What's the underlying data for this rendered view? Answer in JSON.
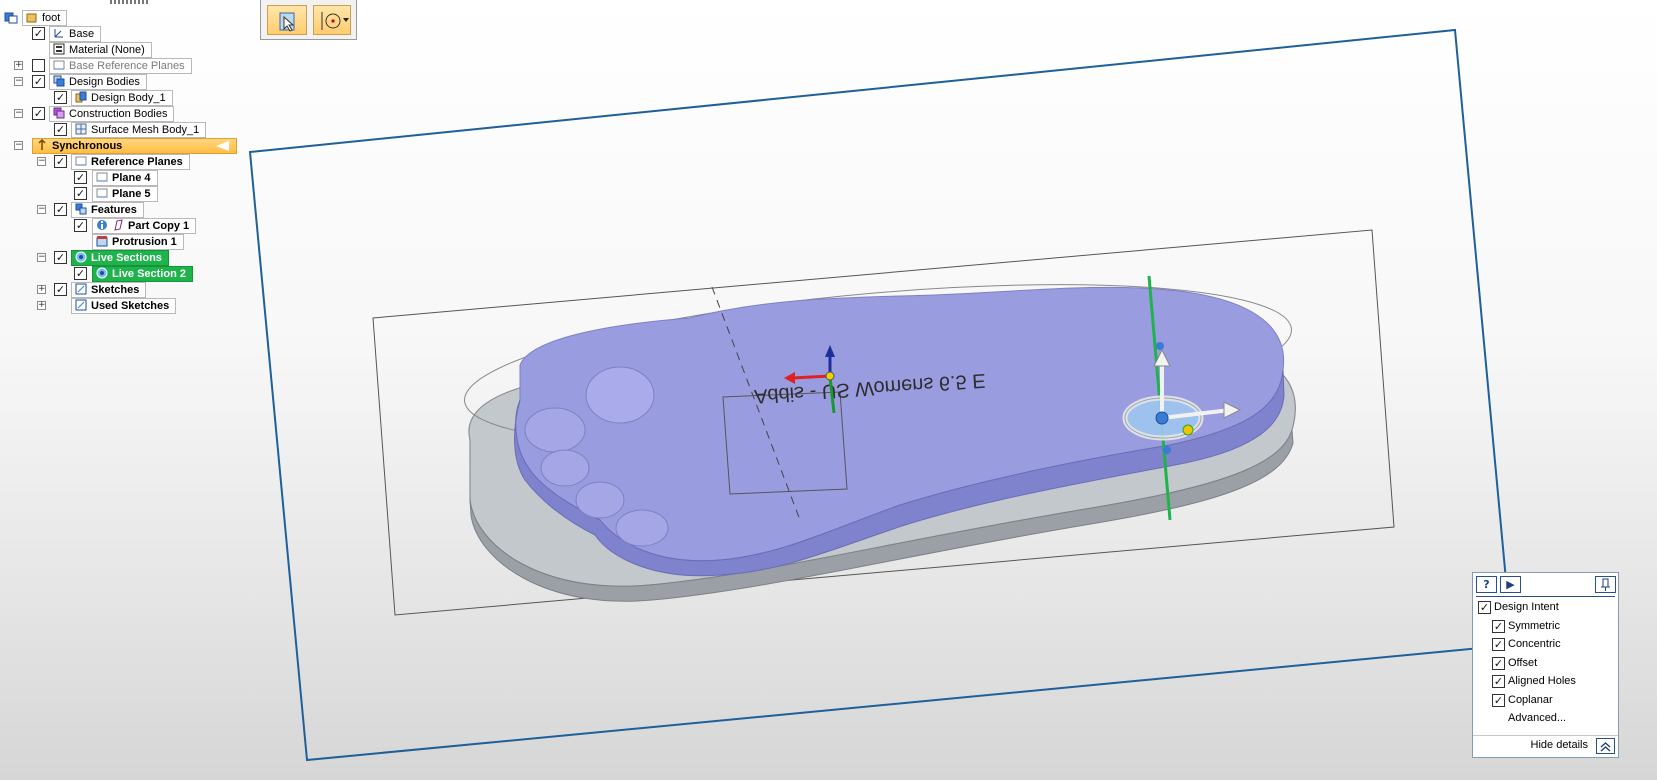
{
  "tree": {
    "root": "foot",
    "base": "Base",
    "material": "Material (None)",
    "base_ref_planes": "Base Reference Planes",
    "design_bodies": "Design Bodies",
    "design_body_1": "Design Body_1",
    "construction_bodies": "Construction Bodies",
    "surface_mesh_body_1": "Surface Mesh Body_1",
    "synchronous": "Synchronous",
    "reference_planes": "Reference Planes",
    "plane_4": "Plane 4",
    "plane_5": "Plane 5",
    "features": "Features",
    "part_copy_1": "Part Copy 1",
    "protrusion_1": "Protrusion 1",
    "live_sections": "Live Sections",
    "live_section_2": "Live Section 2",
    "sketches": "Sketches",
    "used_sketches": "Used Sketches"
  },
  "viewport": {
    "engraved_text": "Addis - US Womens 6.5 E"
  },
  "design_intent": {
    "help": "?",
    "play": "▶",
    "header": "Design Intent",
    "symmetric": "Symmetric",
    "concentric": "Concentric",
    "offset": "Offset",
    "aligned_holes": "Aligned Holes",
    "coplanar": "Coplanar",
    "advanced": "Advanced...",
    "hide_details": "Hide details"
  },
  "colors": {
    "accent_orange": "#ffc560",
    "live_green": "#1fb44b",
    "plane_blue": "#1f5f9a",
    "foot_fill": "#9a9ce0"
  },
  "icons": [
    "part-icon",
    "base-csys-icon",
    "material-icon",
    "ref-plane-icon",
    "body-icon",
    "construction-body-icon",
    "mesh-body-icon",
    "sync-icon",
    "feature-icon",
    "part-copy-icon",
    "protrusion-icon",
    "live-section-icon",
    "sketch-icon",
    "steering-wheel-icon"
  ]
}
